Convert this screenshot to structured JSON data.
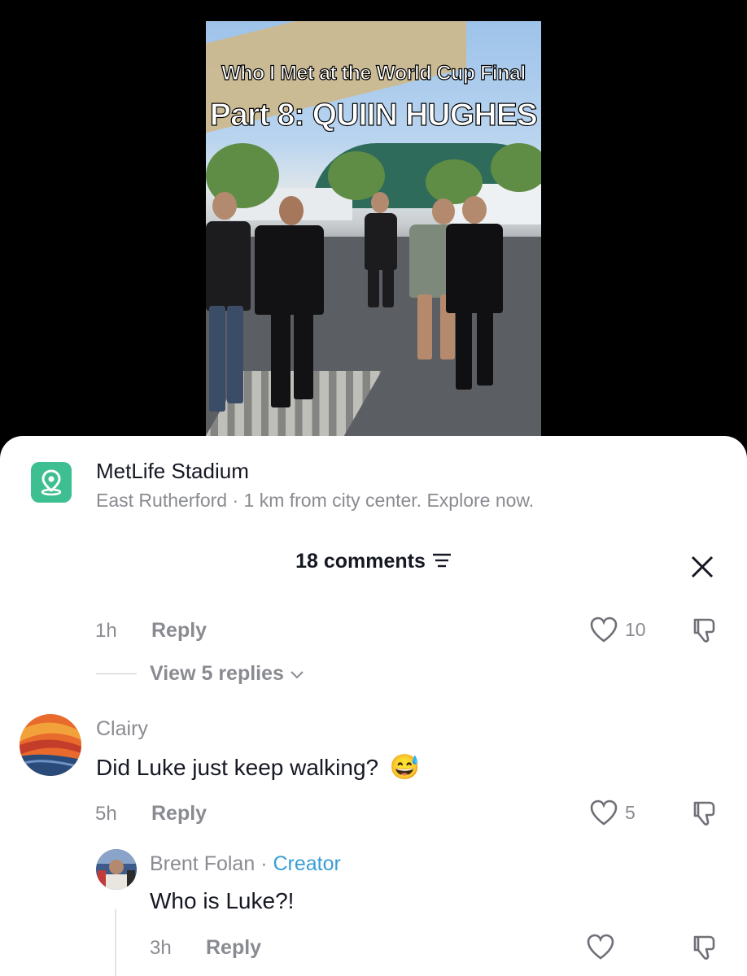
{
  "video": {
    "title_line1": "Who I Met at the World Cup Final",
    "title_line2": "Part 8: QUIIN HUGHES"
  },
  "location": {
    "icon": "location-pin-icon",
    "title": "MetLife Stadium",
    "subtitle": "East Rutherford · 1 km from city center. Explore now.",
    "accent": "#3ebf91"
  },
  "header": {
    "comments_count": "18 comments",
    "filter_icon": "filter-icon",
    "close_icon": "close-icon"
  },
  "comments": [
    {
      "time": "1h",
      "reply_label": "Reply",
      "likes": "10",
      "view_replies": "View 5 replies"
    },
    {
      "author": "Clairy",
      "text": "Did Luke just keep walking?",
      "emoji": "😅",
      "time": "5h",
      "reply_label": "Reply",
      "likes": "5"
    },
    {
      "author": "Brent Folan",
      "separator": " · ",
      "badge": "Creator",
      "text": "Who is Luke?!",
      "time": "3h",
      "reply_label": "Reply",
      "likes": ""
    }
  ],
  "colors": {
    "link": "#3a9ed6",
    "muted": "#8a8b91",
    "text": "#161823"
  }
}
